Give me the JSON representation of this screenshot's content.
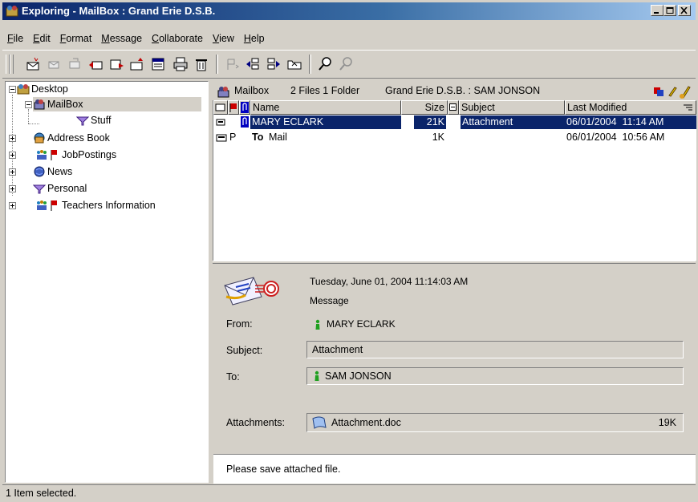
{
  "window": {
    "title": "Exploring - MailBox : Grand Erie D.S.B."
  },
  "menu": [
    "File",
    "Edit",
    "Format",
    "Message",
    "Collaborate",
    "View",
    "Help"
  ],
  "toolbar": {
    "icons": [
      "new-mail-icon",
      "reply-icon",
      "forward-icon",
      "reply-all-icon",
      "send-icon",
      "new-folder-icon",
      "properties-icon",
      "print-icon",
      "delete-icon",
      "flag-icon",
      "move-left-icon",
      "move-right-icon",
      "folder-up-icon",
      "find-icon",
      "advanced-find-icon"
    ]
  },
  "tree": {
    "desktop": "Desktop",
    "mailbox": "MailBox",
    "stuff": "Stuff",
    "address_book": "Address Book",
    "job_postings": "JobPostings",
    "news": "News",
    "personal": "Personal",
    "teachers": "Teachers Information"
  },
  "list_header": {
    "location": "Mailbox",
    "summary": "2 Files 1 Folder",
    "account": "Grand Erie D.S.B. : SAM JONSON"
  },
  "columns": {
    "name": "Name",
    "size": "Size",
    "subject": "Subject",
    "modified": "Last Modified"
  },
  "rows": [
    {
      "name": "MARY ECLARK",
      "size": "21K",
      "subject": "Attachment",
      "modified": "06/01/2004  11:14 AM",
      "type_mark": "",
      "selected": true
    },
    {
      "name_prefix": "To",
      "name": "Mail",
      "size": "1K",
      "subject": "",
      "modified": "06/01/2004  10:56 AM",
      "type_mark": "P",
      "selected": false
    }
  ],
  "preview": {
    "date": "Tuesday, June 01, 2004 11:14:03 AM",
    "kind": "Message",
    "from_label": "From:",
    "from": "MARY ECLARK",
    "subject_label": "Subject:",
    "subject": "Attachment",
    "to_label": "To:",
    "to": "SAM JONSON",
    "attachments_label": "Attachments:",
    "attachment_name": "Attachment.doc",
    "attachment_size": "19K",
    "message_body": "Please save attached file."
  },
  "status": {
    "text": "1 Item selected."
  },
  "colors": {
    "title_start": "#0a246a",
    "title_end": "#a6caf0",
    "selection": "#0a246a",
    "face": "#d4d0c8",
    "flag": "#cc0000"
  }
}
